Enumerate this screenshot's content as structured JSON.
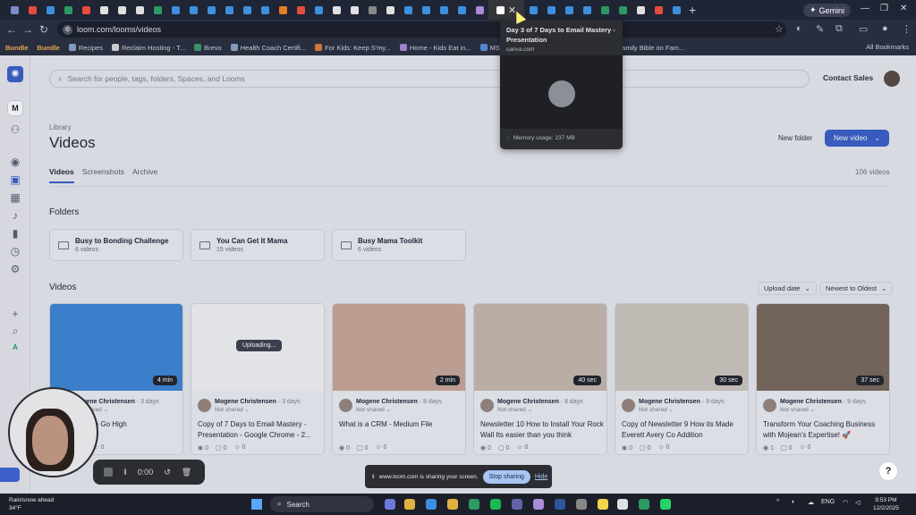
{
  "browser": {
    "url": "loom.com/looms/videos",
    "gemini_label": "Gemini",
    "bookmarks": [
      {
        "label": "Bundle",
        "color": "#f4b45d"
      },
      {
        "label": "Bundle",
        "color": "#f4b45d"
      },
      {
        "label": "Recipes",
        "color": "#8ea3c9"
      },
      {
        "label": "Reclaim Hosting - T...",
        "color": "#d6d6d6"
      },
      {
        "label": "Brevo",
        "color": "#3b9c6a"
      },
      {
        "label": "Health Coach Certifi...",
        "color": "#8ea3c9"
      },
      {
        "label": "For Kids: Keep S'my...",
        "color": "#e07b39"
      },
      {
        "label": "Home - Kids Eat in...",
        "color": "#a98bd6"
      },
      {
        "label": "MS and Mo",
        "color": "#5a8be0"
      },
      {
        "label": "Skool Social Scout",
        "color": "#e0e0e0"
      },
      {
        "label": "Family Bible on Fam...",
        "color": "#c9b06b"
      }
    ],
    "all_bookmarks": "All Bookmarks"
  },
  "tab_popup": {
    "title": "Day 3 of 7 Days to Email Mastery - Presentation",
    "domain": "canva.com",
    "memory": "Memory usage: 237 MB"
  },
  "sidebar": {
    "workspace_initial": "M",
    "bottom_initial": "A"
  },
  "header": {
    "search_placeholder": "Search for people, tags, folders, Spaces, and Looms",
    "contact_sales": "Contact Sales"
  },
  "page": {
    "breadcrumb": "Library",
    "title": "Videos",
    "new_folder": "New folder",
    "new_video": "New video",
    "tabs": [
      "Videos",
      "Screenshots",
      "Archive"
    ],
    "video_count": "106 videos",
    "folders_heading": "Folders",
    "videos_heading": "Videos",
    "sort_upload": "Upload date",
    "sort_order": "Newest to Oldest"
  },
  "folders": [
    {
      "name": "Busy to Bonding Challenge",
      "count": "6 videos"
    },
    {
      "name": "You Can Get It Mama",
      "count": "15 videos"
    },
    {
      "name": "Busy Mama Toolkit",
      "count": "6 videos"
    }
  ],
  "videos": [
    {
      "owner": "Mogene Christensen",
      "when": "3 days",
      "shared": "Not shared",
      "title": "Four Email in Go High",
      "duration": "4 min",
      "views": "0",
      "comments": "0",
      "reactions": "0",
      "thumb": "#3e86d6"
    },
    {
      "owner": "Mogene Christensen",
      "when": "3 days",
      "shared": "Not shared",
      "title": "Copy of 7 Days to Email Mastery - Presentation - Google Chrome - 2...",
      "duration": "",
      "uploading": "Uploading...",
      "views": "0",
      "comments": "0",
      "reactions": "0",
      "thumb": "#f2f3f6"
    },
    {
      "owner": "Mogene Christensen",
      "when": "8 days",
      "shared": "Not shared",
      "title": "What is a CRM - Medium File",
      "duration": "2 min",
      "views": "0",
      "comments": "0",
      "reactions": "0",
      "thumb": "#c9a89a"
    },
    {
      "owner": "Mogene Christensen",
      "when": "8 days",
      "shared": "Not shared",
      "title": "Newsletter 10 How to Install Your Rock Wall Its easier than you think",
      "duration": "40 sec",
      "views": "0",
      "comments": "0",
      "reactions": "0",
      "thumb": "#c7b9b0"
    },
    {
      "owner": "Mogene Christensen",
      "when": "9 days",
      "shared": "Not shared",
      "title": "Copy of Newsletter 9 How its Made Everett Avery Co Addition",
      "duration": "30 sec",
      "views": "0",
      "comments": "0",
      "reactions": "0",
      "thumb": "#cfc7c1"
    },
    {
      "owner": "Mogene Christensen",
      "when": "9 days",
      "shared": "Not shared",
      "title": "Transform Your Coaching Business with Mojean's Expertise! 🚀",
      "duration": "37 sec",
      "views": "1",
      "comments": "0",
      "reactions": "0",
      "thumb": "#7a6a5e"
    }
  ],
  "recorder": {
    "time": "0:00"
  },
  "share_bar": {
    "message": "www.loom.com is sharing your screen.",
    "stop": "Stop sharing",
    "hide": "Hide"
  },
  "help": "?",
  "taskbar": {
    "weather": "Rain/snow ahead",
    "temp": "34°F",
    "search": "Search",
    "lang": "ENG",
    "time": "9:53 PM",
    "date": "12/2/2025",
    "badge": "1"
  },
  "colors": {
    "accent": "#3b60c9",
    "stop": "#a8c5f3"
  }
}
